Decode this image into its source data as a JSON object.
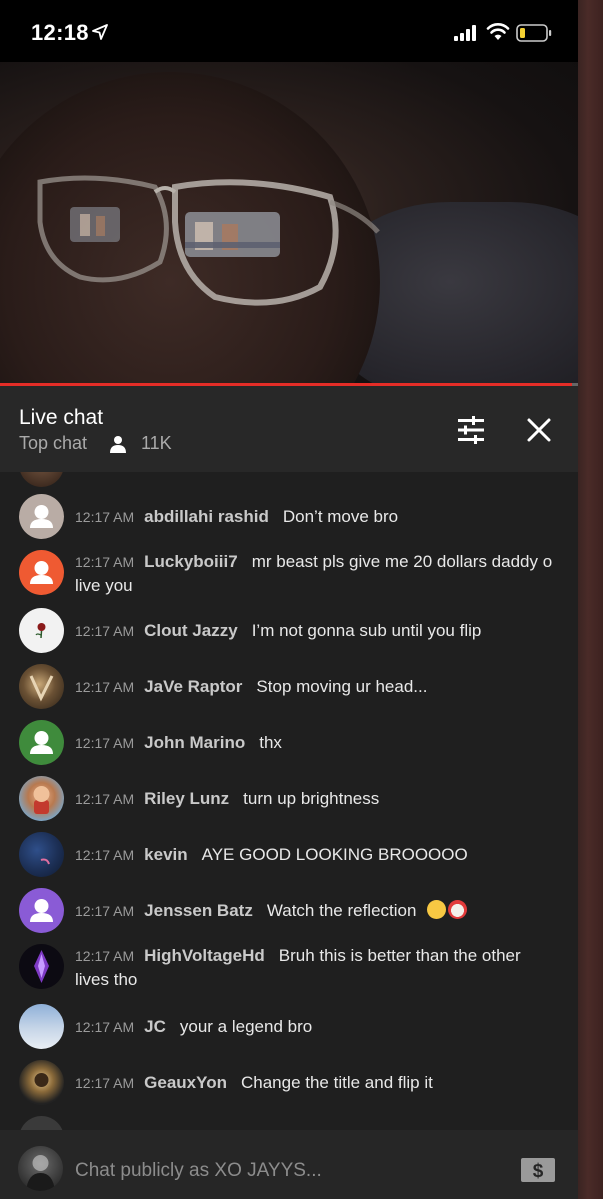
{
  "status_bar": {
    "time": "12:18"
  },
  "chat": {
    "title": "Live chat",
    "mode": "Top chat",
    "viewers": "11K"
  },
  "messages": [
    {
      "time": "12:17 AM",
      "author": "abdillahi rashid",
      "text": "Don’t move bro",
      "avatar": "default-gray"
    },
    {
      "time": "12:17 AM",
      "author": "Luckyboiii7",
      "text": "mr beast pls give me 20 dollars daddy o",
      "text2": "live you",
      "avatar": "default-orange"
    },
    {
      "time": "12:17 AM",
      "author": "Clout Jazzy",
      "text": "I’m not gonna sub until you flip",
      "avatar": "rose-white"
    },
    {
      "time": "12:17 AM",
      "author": "JaVe Raptor",
      "text": "Stop moving ur head...",
      "avatar": "raptor-photo"
    },
    {
      "time": "12:17 AM",
      "author": "John Marino",
      "text": "thx",
      "avatar": "default-green"
    },
    {
      "time": "12:17 AM",
      "author": "Riley Lunz",
      "text": "turn up brightness",
      "avatar": "cartoon-character"
    },
    {
      "time": "12:17 AM",
      "author": "kevin",
      "text": "AYE GOOD LOOKING BROOOOO",
      "avatar": "dark-blue-photo"
    },
    {
      "time": "12:17 AM",
      "author": "Jenssen Batz",
      "text": "Watch the reflection",
      "emoji": [
        "laughing-emoji",
        "clown-emoji"
      ],
      "avatar": "default-purple"
    },
    {
      "time": "12:17 AM",
      "author": "HighVoltageHd",
      "text": "Bruh this is better than the other",
      "text2": "lives tho",
      "avatar": "purple-crystal"
    },
    {
      "time": "12:17 AM",
      "author": "JC",
      "text": "your a legend bro",
      "avatar": "sky-clouds"
    },
    {
      "time": "12:17 AM",
      "author": "GeauxYon",
      "text": "Change the title and flip it",
      "avatar": "person-photo"
    }
  ],
  "input": {
    "placeholder": "Chat publicly as XO JAYYS..."
  },
  "colors": {
    "accent": "#e52d27",
    "background": "#1f1f1f",
    "header": "#282828"
  }
}
